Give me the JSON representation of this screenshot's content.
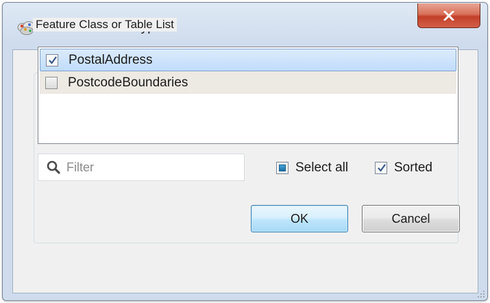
{
  "window": {
    "title": "Select Feature Types",
    "close_symbol": "X"
  },
  "group": {
    "label": "Feature Class or Table List"
  },
  "list": {
    "items": [
      {
        "label": "PostalAddress",
        "checked": true,
        "selected": true
      },
      {
        "label": "PostcodeBoundaries",
        "checked": false,
        "selected": false
      }
    ]
  },
  "filter": {
    "placeholder": "Filter",
    "value": ""
  },
  "options": {
    "select_all_label": "Select all",
    "select_all_state": "indeterminate",
    "sorted_label": "Sorted",
    "sorted_checked": true
  },
  "buttons": {
    "ok_label": "OK",
    "cancel_label": "Cancel"
  },
  "icons": {
    "app": "app-icon",
    "close": "close-icon",
    "search": "search-icon",
    "check": "checkmark-icon",
    "grip": "resize-grip-icon"
  },
  "colors": {
    "title_bar": "#cfdced",
    "close_button": "#c2402a",
    "selection_highlight": "#c1dcfc",
    "ok_button": "#bee6fd"
  }
}
